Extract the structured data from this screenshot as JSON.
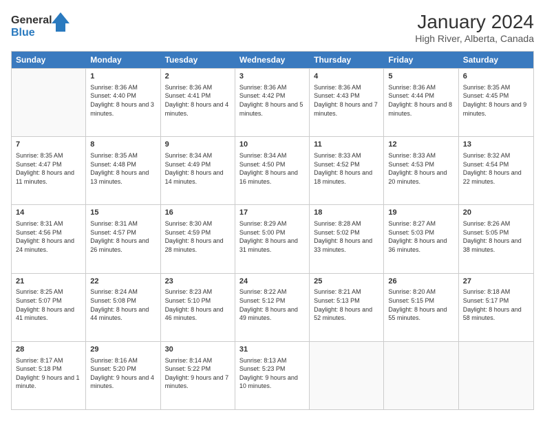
{
  "header": {
    "logo_line1": "General",
    "logo_line2": "Blue",
    "month_title": "January 2024",
    "location": "High River, Alberta, Canada"
  },
  "days_of_week": [
    "Sunday",
    "Monday",
    "Tuesday",
    "Wednesday",
    "Thursday",
    "Friday",
    "Saturday"
  ],
  "weeks": [
    [
      {
        "day": null,
        "info": null
      },
      {
        "day": "1",
        "sunrise": "Sunrise: 8:36 AM",
        "sunset": "Sunset: 4:40 PM",
        "daylight": "Daylight: 8 hours and 3 minutes."
      },
      {
        "day": "2",
        "sunrise": "Sunrise: 8:36 AM",
        "sunset": "Sunset: 4:41 PM",
        "daylight": "Daylight: 8 hours and 4 minutes."
      },
      {
        "day": "3",
        "sunrise": "Sunrise: 8:36 AM",
        "sunset": "Sunset: 4:42 PM",
        "daylight": "Daylight: 8 hours and 5 minutes."
      },
      {
        "day": "4",
        "sunrise": "Sunrise: 8:36 AM",
        "sunset": "Sunset: 4:43 PM",
        "daylight": "Daylight: 8 hours and 7 minutes."
      },
      {
        "day": "5",
        "sunrise": "Sunrise: 8:36 AM",
        "sunset": "Sunset: 4:44 PM",
        "daylight": "Daylight: 8 hours and 8 minutes."
      },
      {
        "day": "6",
        "sunrise": "Sunrise: 8:35 AM",
        "sunset": "Sunset: 4:45 PM",
        "daylight": "Daylight: 8 hours and 9 minutes."
      }
    ],
    [
      {
        "day": "7",
        "sunrise": "Sunrise: 8:35 AM",
        "sunset": "Sunset: 4:47 PM",
        "daylight": "Daylight: 8 hours and 11 minutes."
      },
      {
        "day": "8",
        "sunrise": "Sunrise: 8:35 AM",
        "sunset": "Sunset: 4:48 PM",
        "daylight": "Daylight: 8 hours and 13 minutes."
      },
      {
        "day": "9",
        "sunrise": "Sunrise: 8:34 AM",
        "sunset": "Sunset: 4:49 PM",
        "daylight": "Daylight: 8 hours and 14 minutes."
      },
      {
        "day": "10",
        "sunrise": "Sunrise: 8:34 AM",
        "sunset": "Sunset: 4:50 PM",
        "daylight": "Daylight: 8 hours and 16 minutes."
      },
      {
        "day": "11",
        "sunrise": "Sunrise: 8:33 AM",
        "sunset": "Sunset: 4:52 PM",
        "daylight": "Daylight: 8 hours and 18 minutes."
      },
      {
        "day": "12",
        "sunrise": "Sunrise: 8:33 AM",
        "sunset": "Sunset: 4:53 PM",
        "daylight": "Daylight: 8 hours and 20 minutes."
      },
      {
        "day": "13",
        "sunrise": "Sunrise: 8:32 AM",
        "sunset": "Sunset: 4:54 PM",
        "daylight": "Daylight: 8 hours and 22 minutes."
      }
    ],
    [
      {
        "day": "14",
        "sunrise": "Sunrise: 8:31 AM",
        "sunset": "Sunset: 4:56 PM",
        "daylight": "Daylight: 8 hours and 24 minutes."
      },
      {
        "day": "15",
        "sunrise": "Sunrise: 8:31 AM",
        "sunset": "Sunset: 4:57 PM",
        "daylight": "Daylight: 8 hours and 26 minutes."
      },
      {
        "day": "16",
        "sunrise": "Sunrise: 8:30 AM",
        "sunset": "Sunset: 4:59 PM",
        "daylight": "Daylight: 8 hours and 28 minutes."
      },
      {
        "day": "17",
        "sunrise": "Sunrise: 8:29 AM",
        "sunset": "Sunset: 5:00 PM",
        "daylight": "Daylight: 8 hours and 31 minutes."
      },
      {
        "day": "18",
        "sunrise": "Sunrise: 8:28 AM",
        "sunset": "Sunset: 5:02 PM",
        "daylight": "Daylight: 8 hours and 33 minutes."
      },
      {
        "day": "19",
        "sunrise": "Sunrise: 8:27 AM",
        "sunset": "Sunset: 5:03 PM",
        "daylight": "Daylight: 8 hours and 36 minutes."
      },
      {
        "day": "20",
        "sunrise": "Sunrise: 8:26 AM",
        "sunset": "Sunset: 5:05 PM",
        "daylight": "Daylight: 8 hours and 38 minutes."
      }
    ],
    [
      {
        "day": "21",
        "sunrise": "Sunrise: 8:25 AM",
        "sunset": "Sunset: 5:07 PM",
        "daylight": "Daylight: 8 hours and 41 minutes."
      },
      {
        "day": "22",
        "sunrise": "Sunrise: 8:24 AM",
        "sunset": "Sunset: 5:08 PM",
        "daylight": "Daylight: 8 hours and 44 minutes."
      },
      {
        "day": "23",
        "sunrise": "Sunrise: 8:23 AM",
        "sunset": "Sunset: 5:10 PM",
        "daylight": "Daylight: 8 hours and 46 minutes."
      },
      {
        "day": "24",
        "sunrise": "Sunrise: 8:22 AM",
        "sunset": "Sunset: 5:12 PM",
        "daylight": "Daylight: 8 hours and 49 minutes."
      },
      {
        "day": "25",
        "sunrise": "Sunrise: 8:21 AM",
        "sunset": "Sunset: 5:13 PM",
        "daylight": "Daylight: 8 hours and 52 minutes."
      },
      {
        "day": "26",
        "sunrise": "Sunrise: 8:20 AM",
        "sunset": "Sunset: 5:15 PM",
        "daylight": "Daylight: 8 hours and 55 minutes."
      },
      {
        "day": "27",
        "sunrise": "Sunrise: 8:18 AM",
        "sunset": "Sunset: 5:17 PM",
        "daylight": "Daylight: 8 hours and 58 minutes."
      }
    ],
    [
      {
        "day": "28",
        "sunrise": "Sunrise: 8:17 AM",
        "sunset": "Sunset: 5:18 PM",
        "daylight": "Daylight: 9 hours and 1 minute."
      },
      {
        "day": "29",
        "sunrise": "Sunrise: 8:16 AM",
        "sunset": "Sunset: 5:20 PM",
        "daylight": "Daylight: 9 hours and 4 minutes."
      },
      {
        "day": "30",
        "sunrise": "Sunrise: 8:14 AM",
        "sunset": "Sunset: 5:22 PM",
        "daylight": "Daylight: 9 hours and 7 minutes."
      },
      {
        "day": "31",
        "sunrise": "Sunrise: 8:13 AM",
        "sunset": "Sunset: 5:23 PM",
        "daylight": "Daylight: 9 hours and 10 minutes."
      },
      {
        "day": null,
        "info": null
      },
      {
        "day": null,
        "info": null
      },
      {
        "day": null,
        "info": null
      }
    ]
  ]
}
